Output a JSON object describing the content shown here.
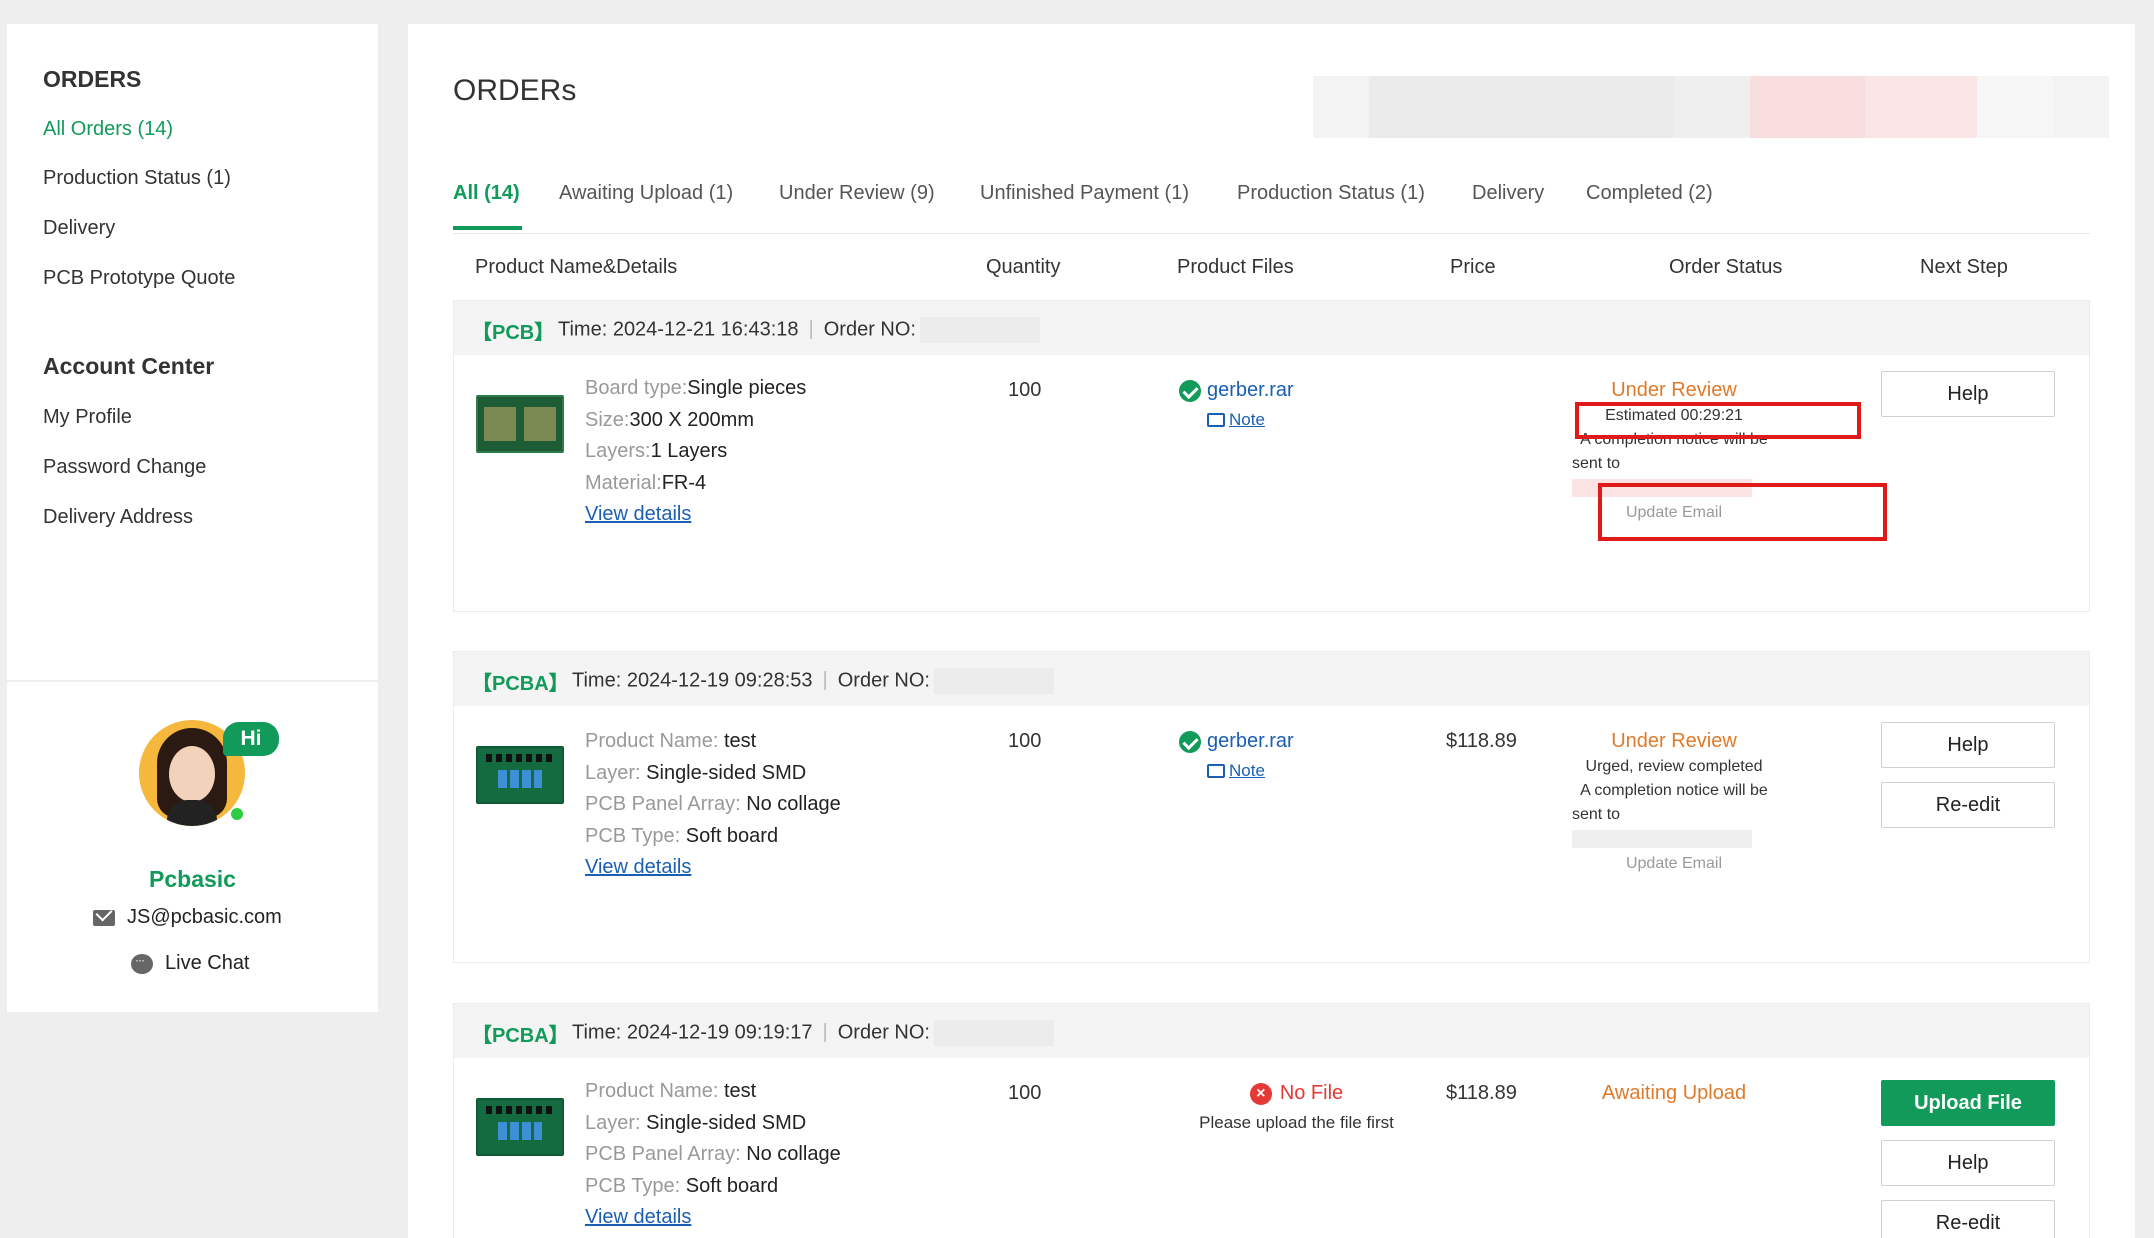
{
  "sidebar": {
    "orders_title": "ORDERS",
    "orders_items": [
      "All Orders (14)",
      "Production Status (1)",
      "Delivery",
      "PCB Prototype Quote"
    ],
    "account_title": "Account Center",
    "account_items": [
      "My Profile",
      "Password Change",
      "Delivery Address"
    ],
    "badge": "Hi",
    "brand": "Pcbasic",
    "email": "JS@pcbasic.com",
    "chat": "Live Chat"
  },
  "main": {
    "title": "ORDERs",
    "tabs": [
      "All (14)",
      "Awaiting Upload (1)",
      "Under Review (9)",
      "Unfinished Payment (1)",
      "Production Status (1)",
      "Delivery",
      "Completed (2)"
    ],
    "columns": [
      "Product Name&Details",
      "Quantity",
      "Product Files",
      "Price",
      "Order Status",
      "Next Step"
    ]
  },
  "orders": [
    {
      "tag": "【PCB】",
      "time": "Time: 2024-12-21 16:43:18",
      "order_no_label": "Order NO:",
      "details": [
        {
          "label": "Board type:",
          "value": "Single pieces"
        },
        {
          "label": "Size:",
          "value": "300 X 200mm"
        },
        {
          "label": "Layers:",
          "value": "1 Layers"
        },
        {
          "label": "Material:",
          "value": "FR-4"
        }
      ],
      "view_details": "View details",
      "quantity": "100",
      "file": "gerber.rar",
      "note": "Note",
      "price": "",
      "status": "Under Review",
      "status_line1": "Estimated 00:29:21",
      "status_line2": "A completion notice will be",
      "status_sent": "sent to",
      "update_email": "Update Email",
      "buttons": [
        "Help"
      ]
    },
    {
      "tag": "【PCBA】",
      "time": "Time: 2024-12-19 09:28:53",
      "order_no_label": "Order NO:",
      "details": [
        {
          "label": "Product Name: ",
          "value": "test"
        },
        {
          "label": "Layer: ",
          "value": "Single-sided SMD"
        },
        {
          "label": "PCB Panel Array: ",
          "value": "No collage"
        },
        {
          "label": "PCB Type: ",
          "value": "Soft board"
        }
      ],
      "view_details": "View details",
      "quantity": "100",
      "file": "gerber.rar",
      "note": "Note",
      "price": "$118.89",
      "status": "Under Review",
      "status_line1": "Urged, review completed",
      "status_line2": "A completion notice will be",
      "status_sent": "sent to",
      "update_email": "Update Email",
      "buttons": [
        "Help",
        "Re-edit"
      ]
    },
    {
      "tag": "【PCBA】",
      "time": "Time: 2024-12-19 09:19:17",
      "order_no_label": "Order NO:",
      "details": [
        {
          "label": "Product Name: ",
          "value": "test"
        },
        {
          "label": "Layer: ",
          "value": "Single-sided SMD"
        },
        {
          "label": "PCB Panel Array: ",
          "value": "No collage"
        },
        {
          "label": "PCB Type: ",
          "value": "Soft board"
        }
      ],
      "view_details": "View details",
      "quantity": "100",
      "no_file": "No File",
      "no_file_hint": "Please upload the file first",
      "price": "$118.89",
      "status": "Awaiting Upload",
      "buttons": [
        "Upload File",
        "Help",
        "Re-edit"
      ]
    }
  ],
  "colors": {
    "accent": "#119a5a",
    "status_orange": "#e07a2b",
    "link": "#1a5fb4",
    "error": "#e53935",
    "annotation": "#e01919"
  }
}
